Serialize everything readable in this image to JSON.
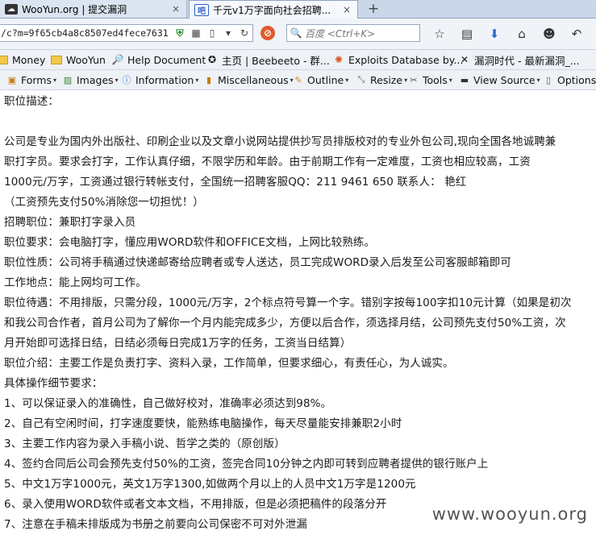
{
  "tabs": [
    {
      "title": "WooYun.org | 提交漏洞",
      "favicon": "wooyun-logo-icon",
      "active": false
    },
    {
      "title": "千元v1万字面向社会招聘...",
      "favicon": "baidu-paw-icon",
      "active": true
    }
  ],
  "tab_close_glyph": "×",
  "new_tab_glyph": "+",
  "address_bar": {
    "url": "/c?m=9f65cb4a8c8507ed4fece7631"
  },
  "search_box": {
    "placeholder": "百度 <Ctrl+K>"
  },
  "bookmarks": [
    {
      "label": "Money",
      "icon": "folder-icon"
    },
    {
      "label": "WooYun",
      "icon": "folder-icon"
    },
    {
      "label": "Help Document",
      "icon": "magnifier-icon"
    },
    {
      "label": "主页 | Beebeeto - 群...",
      "icon": "beebeeto-icon"
    },
    {
      "label": "Exploits Database by...",
      "icon": "exploit-db-icon"
    },
    {
      "label": "漏洞时代 - 最新漏洞_...",
      "icon": "vul-era-icon"
    }
  ],
  "dev_toolbar": [
    {
      "label": "Forms",
      "icon": "forms-icon"
    },
    {
      "label": "Images",
      "icon": "images-icon"
    },
    {
      "label": "Information",
      "icon": "info-icon"
    },
    {
      "label": "Miscellaneous",
      "icon": "misc-icon"
    },
    {
      "label": "Outline",
      "icon": "pencil-icon"
    },
    {
      "label": "Resize",
      "icon": "resize-icon"
    },
    {
      "label": "Tools",
      "icon": "tools-icon"
    },
    {
      "label": "View Source",
      "icon": "view-source-icon"
    },
    {
      "label": "Options",
      "icon": "options-icon"
    }
  ],
  "content_lines": [
    "职位描述：",
    "",
    "公司是专业为国内外出版社、印刷企业以及文章小说网站提供抄写员排版校对的专业外包公司,现向全国各地诚聘兼",
    "职打字员。要求会打字，工作认真仔细，不限学历和年龄。由于前期工作有一定难度，工资也相应较高，工资",
    "1000元/万字，工资通过银行转帐支付，全国统一招聘客服QQ：211 9461 650 联系人： 艳红",
    "（工资预先支付50%消除您一切担忧！）",
    "招聘职位：兼职打字录入员",
    "职位要求：会电脑打字，懂应用WORD软件和OFFICE文档，上网比较熟练。",
    "职位性质：公司将手稿通过快递邮寄给应聘者或专人送达，员工完成WORD录入后发至公司客服邮箱即可",
    "工作地点：能上网均可工作。",
    "职位待遇：不用排版，只需分段，1000元/万字，2个标点符号算一个字。错别字按每100字扣10元计算（如果是初次",
    "和我公司合作者，首月公司为了解你一个月内能完成多少，方便以后合作，须选择月结，公司预先支付50%工资，次",
    "月开始即可选择日结，日结必须每日完成1万字的任务，工资当日结算）",
    "职位介绍：主要工作是负责打字、资料入录，工作简单，但要求细心，有责任心，为人诚实。",
    "具体操作细节要求：",
    "1、可以保证录入的准确性，自己做好校对，准确率必须达到98%。",
    "2、自己有空闲时间，打字速度要快，能熟练电脑操作，每天尽量能安排兼职2小时",
    "3、主要工作内容为录入手稿小说、哲学之类的（原创版）",
    "4、签约合同后公司会预先支付50%的工资，签完合同10分钟之内即可转到应聘者提供的银行账户上",
    "5、中文1万字1000元，英文1万字1300,如做两个月以上的人员中文1万字是1200元",
    "6、录入使用WORD软件或者文本文档，不用排版，但是必须把稿件的段落分开",
    "7、注意在手稿未排版成为书册之前要向公司保密不可对外泄漏"
  ],
  "watermark": "www.wooyun.org",
  "colors": {
    "tab_strip": "#c9d7e8",
    "active_tab": "#f5f8fc",
    "toolbar": "#f0f3f8",
    "stop_button": "#e25b2c",
    "accent_blue": "#2a6fc9"
  }
}
